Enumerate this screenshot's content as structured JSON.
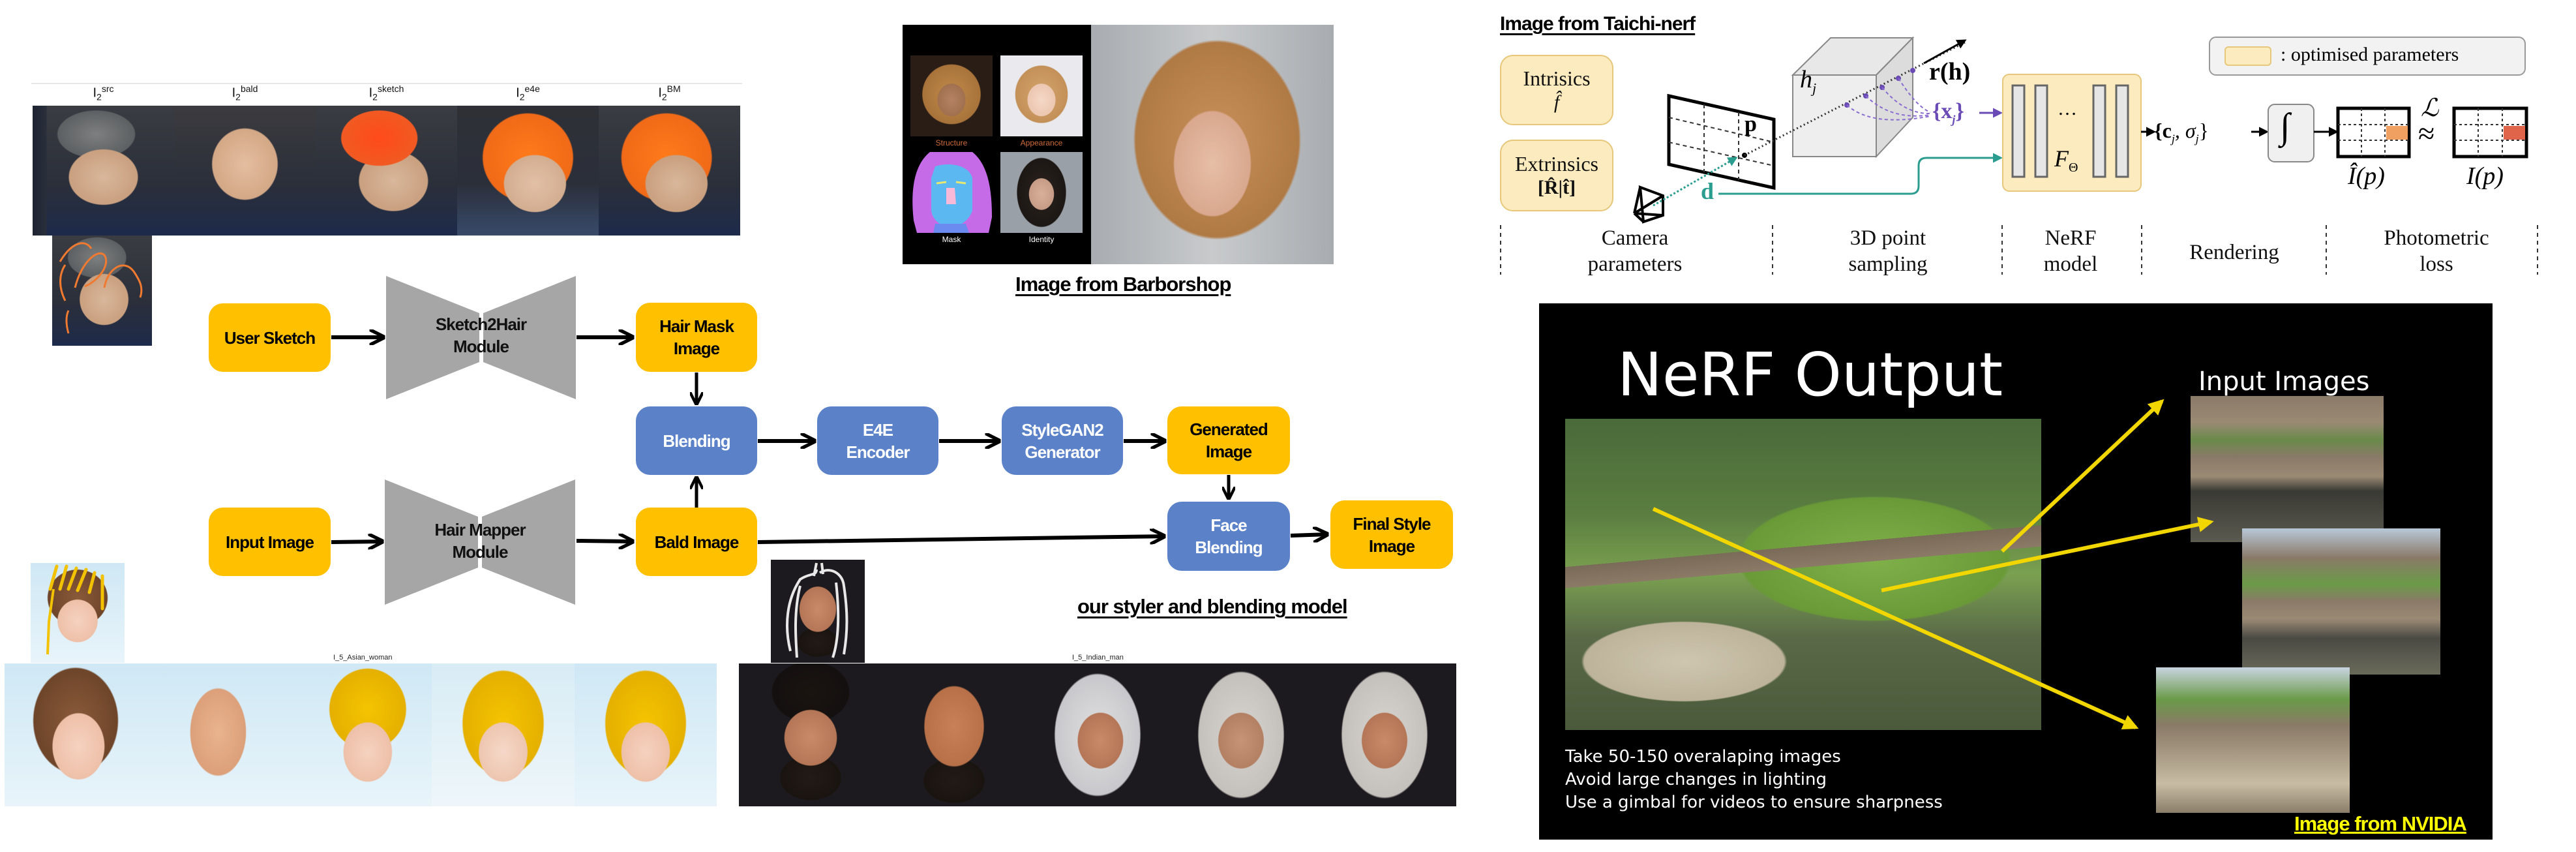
{
  "top_strip": {
    "labels": [
      {
        "base": "I",
        "sub": "2",
        "sup": "src"
      },
      {
        "base": "I",
        "sub": "2",
        "sup": "bald"
      },
      {
        "base": "I",
        "sub": "2",
        "sup": "sketch"
      },
      {
        "base": "I",
        "sub": "2",
        "sup": "e4e"
      },
      {
        "base": "I",
        "sub": "2",
        "sup": "BM"
      }
    ],
    "tiles": [
      "source face (gray hair)",
      "bald face",
      "sketch hair (orange)",
      "e4e result (orange hair)",
      "blended result (orange hair)"
    ],
    "sketch_thumb": "source face with orange sketch strokes"
  },
  "flowchart": {
    "nodes": {
      "user_sketch": "User Sketch",
      "sketch2hair": "Sketch2Hair\nModule",
      "hair_mask": "Hair Mask\nImage",
      "blending": "Blending",
      "input_image": "Input Image",
      "hair_mapper": "Hair Mapper\nModule",
      "bald_image": "Bald Image",
      "e4e": "E4E\nEncoder",
      "stylegan2": "StyleGAN2\nGenerator",
      "generated": "Generated\nImage",
      "face_blending": "Face\nBlending",
      "final_style": "Final Style\nImage"
    },
    "colors": {
      "output_node": "#FFC000",
      "process_node": "#5B82C9",
      "module": "#A6A6A6"
    },
    "caption": "our styler and blending model"
  },
  "barbershop": {
    "caption": "Image from Barborshop",
    "panel_labels": [
      "Structure",
      "Appearance",
      "Mask",
      "Identity"
    ]
  },
  "bottom_rows": [
    {
      "label": "I_5_Asian_woman",
      "sketch_color": "#F2C200",
      "hair_color": "#F2C200"
    },
    {
      "label": "I_5_Indian_man",
      "sketch_color": "#E8E8E8",
      "hair_color": "#D8D8D8"
    }
  ],
  "taichi": {
    "caption": "Image from Taichi-nerf",
    "intrinsics_title": "Intrisics",
    "intrinsics_symbol": "f̂",
    "extrinsics_title": "Extrinsics",
    "extrinsics_symbol": "[R̂|t̂]",
    "legend": ": optimised parameters",
    "symbols": {
      "p": "p",
      "d": "d",
      "hj": "h",
      "hj_sub": "j",
      "rh": "r(h)",
      "xj": "{x",
      "xj_sub": "j",
      "xj_close": "}",
      "f_theta": "F",
      "f_theta_sub": "Θ",
      "dots": "…",
      "cj_sigma": "{c",
      "cj_sub": "j",
      "sigma": ", σ",
      "sigma_sub": "j",
      "cj_close": "}",
      "integral": "∫",
      "approx": "≈",
      "loss": "ℒ",
      "i_hat": "Î(p)",
      "i": "I(p)"
    },
    "sections": [
      "Camera\nparameters",
      "3D point\nsampling",
      "NeRF\nmodel",
      "Rendering",
      "Photometric\nloss"
    ],
    "colors": {
      "param_fill": "#FCEBBE",
      "teal": "#2A9D8F",
      "purple": "#6A4BB5",
      "rendered_pixel": "#F0A060",
      "target_pixel": "#E0644A"
    }
  },
  "nvidia": {
    "title": "NeRF Output",
    "input_title": "Input Images",
    "tips": [
      "Take 50-150 overalaping images",
      "Avoid large changes in lighting",
      "Use a gimbal for videos to ensure sharpness"
    ],
    "caption": "Image from NVIDIA",
    "caption_color": "#FFFF00",
    "arrow_color": "#F2D600"
  }
}
